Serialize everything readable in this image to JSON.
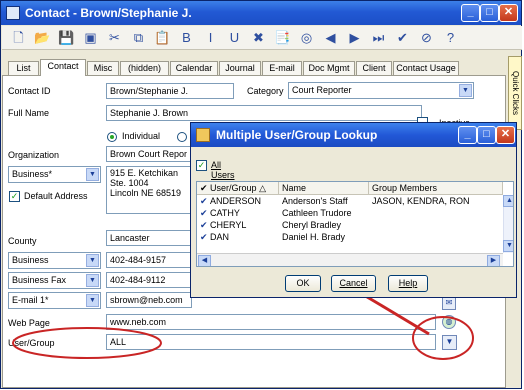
{
  "window": {
    "title": "Contact - Brown/Stephanie J.",
    "minimize_icon": "_",
    "maximize_icon": "□",
    "close_icon": "✕"
  },
  "toolbar": {
    "icons": [
      "new-document-icon",
      "open-folder-icon",
      "save-icon",
      "save-close-icon",
      "cut-icon",
      "copy-icon",
      "paste-icon",
      "bold-icon",
      "italic-icon",
      "underline-icon",
      "delete-icon",
      "clipboard-icon",
      "first-record-icon",
      "previous-record-icon",
      "next-record-icon",
      "last-record-icon",
      "checkmark-icon",
      "cancel-icon",
      "help-icon"
    ],
    "glyphs": [
      "🗋",
      "📂",
      "💾",
      "▣",
      "✂",
      "⧉",
      "📋",
      "B",
      "I",
      "U",
      "✖",
      "📑",
      "◎",
      "◀",
      "▶",
      "⏭",
      "✔",
      "⊘",
      "?"
    ]
  },
  "tabs": [
    "List",
    "Contact",
    "Misc",
    "(hidden)",
    "Calendar",
    "Journal",
    "E-mail",
    "Doc Mgmt",
    "Client",
    "Contact Usage"
  ],
  "quick_clicks": "Quick Clicks",
  "contact": {
    "contact_id_label": "Contact ID",
    "contact_id": "Brown/Stephanie J.",
    "category_label": "Category",
    "category": "Court Reporter",
    "full_name_label": "Full Name",
    "full_name": "Stephanie J. Brown",
    "inactive_label": "Inactive",
    "individual_label": "Individual",
    "organization_label": "Organization",
    "organization": "Brown Court Repor",
    "address_type": "Business*",
    "address_line1": "915 E. Ketchikan",
    "address_line2": "Ste. 1004",
    "address_line3": "Lincoln NE  68519",
    "default_address_label": "Default Address",
    "county_label": "County",
    "county": "Lancaster",
    "phone1_type": "Business",
    "phone1": "402-484-9157",
    "phone2_type": "Business Fax",
    "phone2": "402-484-9112",
    "email_type": "E-mail 1*",
    "email": "sbrown@neb.com",
    "web_page_label": "Web Page",
    "web_page": "www.neb.com",
    "user_group_label": "User/Group",
    "user_group": "ALL"
  },
  "dialog": {
    "title": "Multiple User/Group Lookup",
    "all_users_label": "All Users",
    "columns": [
      "User/Group",
      "Name",
      "Group Members"
    ],
    "sort_indicator": "△",
    "rows": [
      {
        "user_group": "ANDERSON",
        "name": "Anderson's Staff",
        "members": "JASON, KENDRA, RON"
      },
      {
        "user_group": "CATHY",
        "name": "Cathleen Trudore",
        "members": ""
      },
      {
        "user_group": "CHERYL",
        "name": "Cheryl Bradley",
        "members": ""
      },
      {
        "user_group": "DAN",
        "name": "Daniel H. Brady",
        "members": ""
      }
    ],
    "ok_label": "OK",
    "cancel_label": "Cancel",
    "help_label": "Help"
  },
  "colors": {
    "title_bar": "#2259d4",
    "annotation": "#c92525",
    "button_border": "#003c74"
  }
}
